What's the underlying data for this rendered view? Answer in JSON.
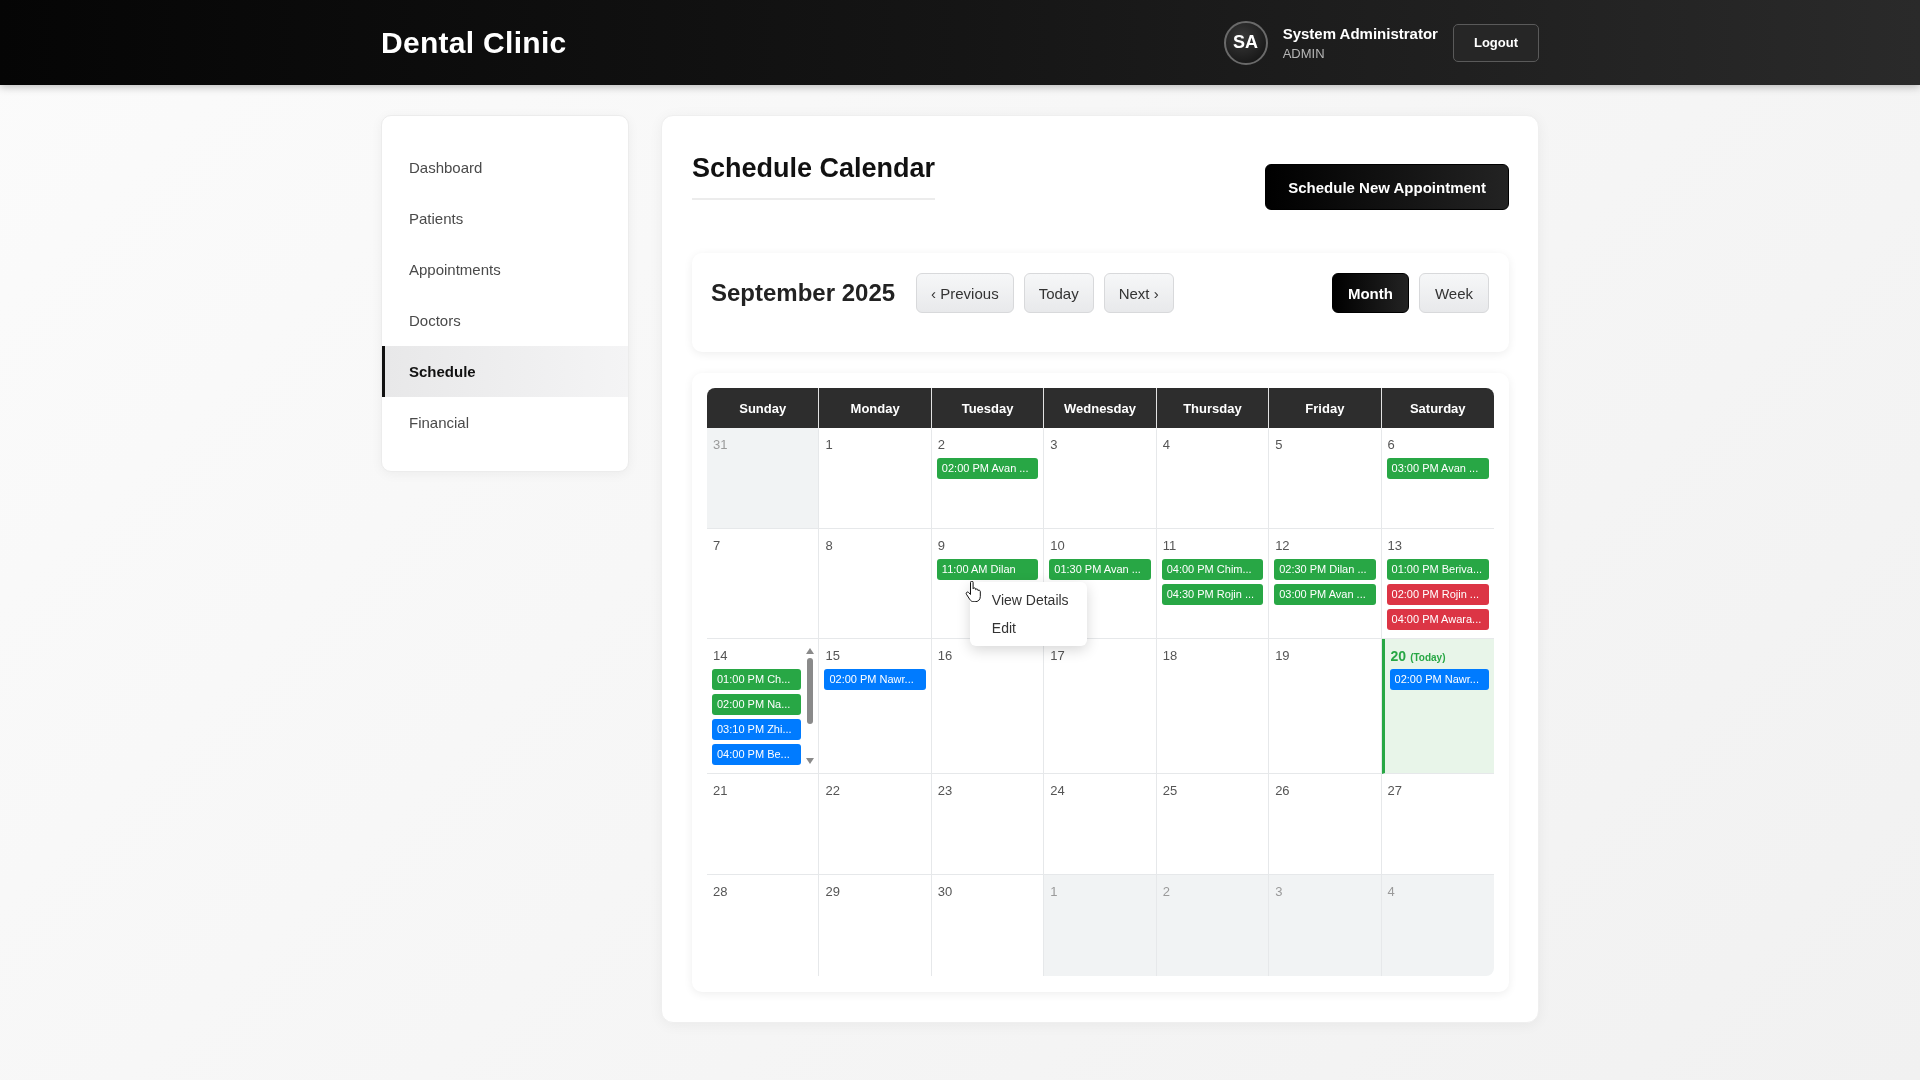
{
  "header": {
    "title": "Dental Clinic",
    "user": {
      "initials": "SA",
      "name": "System Administrator",
      "role": "ADMIN"
    },
    "logout": "Logout"
  },
  "sidebar": {
    "items": [
      {
        "label": "Dashboard",
        "selected": false
      },
      {
        "label": "Patients",
        "selected": false
      },
      {
        "label": "Appointments",
        "selected": false
      },
      {
        "label": "Doctors",
        "selected": false
      },
      {
        "label": "Schedule",
        "selected": true
      },
      {
        "label": "Financial",
        "selected": false
      }
    ]
  },
  "page": {
    "title": "Schedule Calendar",
    "action": "Schedule New Appointment"
  },
  "toolbar": {
    "month": "September 2025",
    "nav": [
      "‹ Previous",
      "Today",
      "Next ›"
    ],
    "views": [
      {
        "label": "Month",
        "selected": true
      },
      {
        "label": "Week",
        "selected": false
      }
    ]
  },
  "calendar": {
    "weekdays": [
      "Sunday",
      "Monday",
      "Tuesday",
      "Wednesday",
      "Thursday",
      "Friday",
      "Saturday"
    ],
    "weeks": [
      [
        {
          "day": "31",
          "outside": true,
          "today": false,
          "scrollable": false
        },
        {
          "day": "1",
          "outside": false,
          "today": false,
          "scrollable": false
        },
        {
          "day": "2",
          "outside": false,
          "today": false,
          "scrollable": false,
          "events": [
            {
              "label": "02:00 PM Avan ...",
              "color": "#28a745"
            }
          ]
        },
        {
          "day": "3",
          "outside": false,
          "today": false,
          "scrollable": false
        },
        {
          "day": "4",
          "outside": false,
          "today": false,
          "scrollable": false
        },
        {
          "day": "5",
          "outside": false,
          "today": false,
          "scrollable": false
        },
        {
          "day": "6",
          "outside": false,
          "today": false,
          "scrollable": false,
          "events": [
            {
              "label": "03:00 PM Avan ...",
              "color": "#28a745"
            }
          ]
        }
      ],
      [
        {
          "day": "7",
          "outside": false,
          "today": false,
          "scrollable": false
        },
        {
          "day": "8",
          "outside": false,
          "today": false,
          "scrollable": false
        },
        {
          "day": "9",
          "outside": false,
          "today": false,
          "scrollable": false,
          "events": [
            {
              "label": "11:00 AM Dilan",
              "color": "#28a745",
              "menu": [
                "View Details",
                "Edit"
              ]
            }
          ]
        },
        {
          "day": "10",
          "outside": false,
          "today": false,
          "scrollable": false,
          "events": [
            {
              "label": "01:30 PM Avan ...",
              "color": "#28a745"
            }
          ]
        },
        {
          "day": "11",
          "outside": false,
          "today": false,
          "scrollable": false,
          "events": [
            {
              "label": "04:00 PM Chim...",
              "color": "#28a745"
            },
            {
              "label": "04:30 PM Rojin ...",
              "color": "#28a745"
            }
          ]
        },
        {
          "day": "12",
          "outside": false,
          "today": false,
          "scrollable": false,
          "events": [
            {
              "label": "02:30 PM Dilan ...",
              "color": "#28a745"
            },
            {
              "label": "03:00 PM Avan ...",
              "color": "#28a745"
            }
          ]
        },
        {
          "day": "13",
          "outside": false,
          "today": false,
          "scrollable": false,
          "events": [
            {
              "label": "01:00 PM Beriva...",
              "color": "#28a745"
            },
            {
              "label": "02:00 PM Rojin ...",
              "color": "#dc3545"
            },
            {
              "label": "04:00 PM Awara...",
              "color": "#dc3545"
            }
          ]
        }
      ],
      [
        {
          "day": "14",
          "outside": false,
          "today": false,
          "scrollable": true,
          "events": [
            {
              "label": "01:00 PM Ch...",
              "color": "#28a745"
            },
            {
              "label": "02:00 PM Na...",
              "color": "#28a745"
            },
            {
              "label": "03:10 PM Zhi...",
              "color": "#007bff"
            },
            {
              "label": "04:00 PM Be...",
              "color": "#007bff"
            }
          ]
        },
        {
          "day": "15",
          "outside": false,
          "today": false,
          "scrollable": false,
          "events": [
            {
              "label": "02:00 PM Nawr...",
              "color": "#007bff"
            }
          ]
        },
        {
          "day": "16",
          "outside": false,
          "today": false,
          "scrollable": false
        },
        {
          "day": "17",
          "outside": false,
          "today": false,
          "scrollable": false
        },
        {
          "day": "18",
          "outside": false,
          "today": false,
          "scrollable": false
        },
        {
          "day": "19",
          "outside": false,
          "today": false,
          "scrollable": false
        },
        {
          "day": "20",
          "outside": false,
          "today": true,
          "note": "(Today)",
          "scrollable": false,
          "events": [
            {
              "label": "02:00 PM Nawr...",
              "color": "#007bff"
            }
          ]
        }
      ],
      [
        {
          "day": "21",
          "outside": false,
          "today": false,
          "scrollable": false
        },
        {
          "day": "22",
          "outside": false,
          "today": false,
          "scrollable": false
        },
        {
          "day": "23",
          "outside": false,
          "today": false,
          "scrollable": false
        },
        {
          "day": "24",
          "outside": false,
          "today": false,
          "scrollable": false
        },
        {
          "day": "25",
          "outside": false,
          "today": false,
          "scrollable": false
        },
        {
          "day": "26",
          "outside": false,
          "today": false,
          "scrollable": false
        },
        {
          "day": "27",
          "outside": false,
          "today": false,
          "scrollable": false
        }
      ],
      [
        {
          "day": "28",
          "outside": false,
          "today": false,
          "scrollable": false
        },
        {
          "day": "29",
          "outside": false,
          "today": false,
          "scrollable": false
        },
        {
          "day": "30",
          "outside": false,
          "today": false,
          "scrollable": false
        },
        {
          "day": "1",
          "outside": true,
          "today": false,
          "scrollable": false
        },
        {
          "day": "2",
          "outside": true,
          "today": false,
          "scrollable": false
        },
        {
          "day": "3",
          "outside": true,
          "today": false,
          "scrollable": false
        },
        {
          "day": "4",
          "outside": true,
          "today": false,
          "scrollable": false
        }
      ]
    ]
  }
}
